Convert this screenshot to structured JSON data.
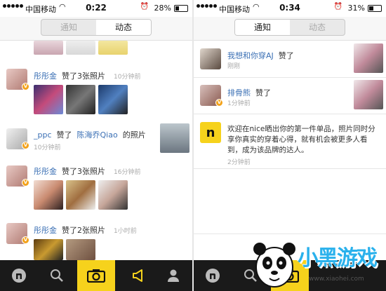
{
  "left": {
    "status": {
      "carrier": "中国移动",
      "time": "0:22",
      "battery": "28%",
      "battery_level": 0.28
    },
    "tabs": {
      "notify": "通知",
      "activity": "动态",
      "active": "activity"
    },
    "feed": [
      {
        "name": "彤彤金",
        "action": "赞了3张照片",
        "time": "10分钟前"
      },
      {
        "name": "_ppc",
        "action_pre": "赞了",
        "target": "陈海乔Qiao",
        "action_post": "的照片",
        "time": "10分钟前"
      },
      {
        "name": "彤彤金",
        "action": "赞了3张照片",
        "time": "16分钟前"
      },
      {
        "name": "彤彤金",
        "action": "赞了2张照片",
        "time": "1小时前"
      }
    ],
    "tabbar": [
      "home-icon",
      "search-icon",
      "camera-icon",
      "megaphone-icon",
      "profile-icon"
    ]
  },
  "right": {
    "status": {
      "carrier": "中国移动",
      "time": "0:34",
      "battery": "31%",
      "battery_level": 0.31
    },
    "tabs": {
      "notify": "通知",
      "activity": "动态",
      "active": "notify"
    },
    "items": [
      {
        "name": "我想和你穿AJ",
        "action": "赞了",
        "time": "刚刚"
      },
      {
        "name": "排骨熊",
        "action": "赞了",
        "time": "1分钟前"
      }
    ],
    "notice": {
      "text": "欢迎在nice晒出你的第一件单品，照片同时分享你真实的穿着心得，就有机会被更多人看到，成为该品牌的达人。",
      "time": "2分钟前",
      "logo": "n"
    }
  },
  "colors": {
    "accent": "#f6d21c",
    "link": "#3a6fb4",
    "badge": "#f3a21a"
  },
  "watermark": {
    "brand": "小黑游戏",
    "url": "www.xiaohei.com"
  }
}
